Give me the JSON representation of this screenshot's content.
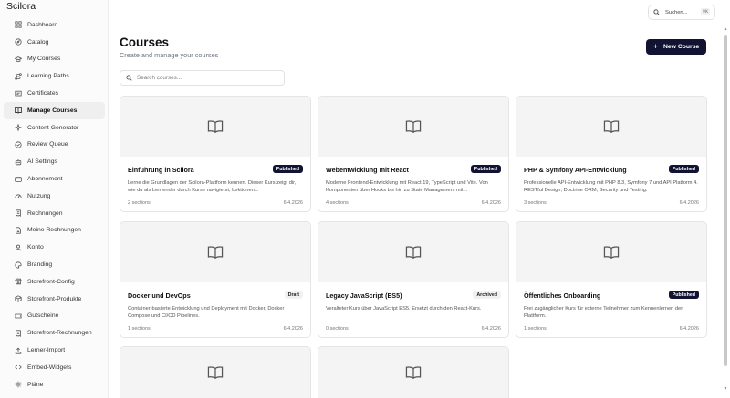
{
  "app": {
    "brand": "Scilora"
  },
  "sidebar": {
    "items": [
      {
        "label": "Dashboard",
        "icon": "grid-icon"
      },
      {
        "label": "Catalog",
        "icon": "compass-icon"
      },
      {
        "label": "My Courses",
        "icon": "graduation-cap-icon"
      },
      {
        "label": "Learning Paths",
        "icon": "route-icon"
      },
      {
        "label": "Certificates",
        "icon": "certificate-icon"
      },
      {
        "label": "Manage Courses",
        "icon": "book-open-icon",
        "active": true
      },
      {
        "label": "Content Generator",
        "icon": "sparkles-icon"
      },
      {
        "label": "Review Queue",
        "icon": "check-circle-icon"
      },
      {
        "label": "AI Settings",
        "icon": "bot-icon"
      },
      {
        "label": "Abonnement",
        "icon": "credit-card-icon"
      },
      {
        "label": "Nutzung",
        "icon": "gauge-icon"
      },
      {
        "label": "Rechnungen",
        "icon": "receipt-icon"
      },
      {
        "label": "Meine Rechnungen",
        "icon": "file-text-icon"
      },
      {
        "label": "Konto",
        "icon": "user-icon"
      },
      {
        "label": "Branding",
        "icon": "palette-icon"
      },
      {
        "label": "Storefront-Config",
        "icon": "store-icon"
      },
      {
        "label": "Storefront-Produkte",
        "icon": "package-icon"
      },
      {
        "label": "Gutscheine",
        "icon": "ticket-icon"
      },
      {
        "label": "Storefront-Rechnungen",
        "icon": "receipt-icon"
      },
      {
        "label": "Lerner-Import",
        "icon": "upload-icon"
      },
      {
        "label": "Embed-Widgets",
        "icon": "code-icon"
      },
      {
        "label": "Pläne",
        "icon": "settings-icon"
      }
    ]
  },
  "topbar": {
    "search_label": "Suchen...",
    "shortcut": "⌘K"
  },
  "page": {
    "title": "Courses",
    "subtitle": "Create and manage your courses",
    "new_button": "New Course",
    "search_placeholder": "Search courses..."
  },
  "courses": [
    {
      "title": "Einführung in Scilora",
      "status": "Published",
      "description": "Lerne die Grundlagen der Scilora-Plattform kennen. Dieser Kurs zeigt dir, wie du als Lernender durch Kurse navigierst, Lektionen...",
      "sections": "2 sections",
      "date": "6.4.2026"
    },
    {
      "title": "Webentwicklung mit React",
      "status": "Published",
      "description": "Moderne Frontend-Entwicklung mit React 19, TypeScript und Vite. Von Komponenten über Hooks bis hin zu State Management mit...",
      "sections": "4 sections",
      "date": "6.4.2026"
    },
    {
      "title": "PHP & Symfony API-Entwicklung",
      "status": "Published",
      "description": "Professionelle API-Entwicklung mit PHP 8.3, Symfony 7 und API Platform 4. RESTful Design, Doctrine ORM, Security und Testing.",
      "sections": "3 sections",
      "date": "6.4.2026"
    },
    {
      "title": "Docker und DevOps",
      "status": "Draft",
      "description": "Container-basierte Entwicklung und Deployment mit Docker, Docker Compose und CI/CD Pipelines.",
      "sections": "1 sections",
      "date": "6.4.2026"
    },
    {
      "title": "Legacy JavaScript (ES5)",
      "status": "Archived",
      "description": "Veralteter Kurs über JavaScript ES5. Ersetzt durch den React-Kurs.",
      "sections": "0 sections",
      "date": "6.4.2026"
    },
    {
      "title": "Öffentliches Onboarding",
      "status": "Published",
      "description": "Frei zugänglicher Kurs für externe Teilnehmer zum Kennenlernen der Plattform.",
      "sections": "1 sections",
      "date": "6.4.2026"
    }
  ]
}
